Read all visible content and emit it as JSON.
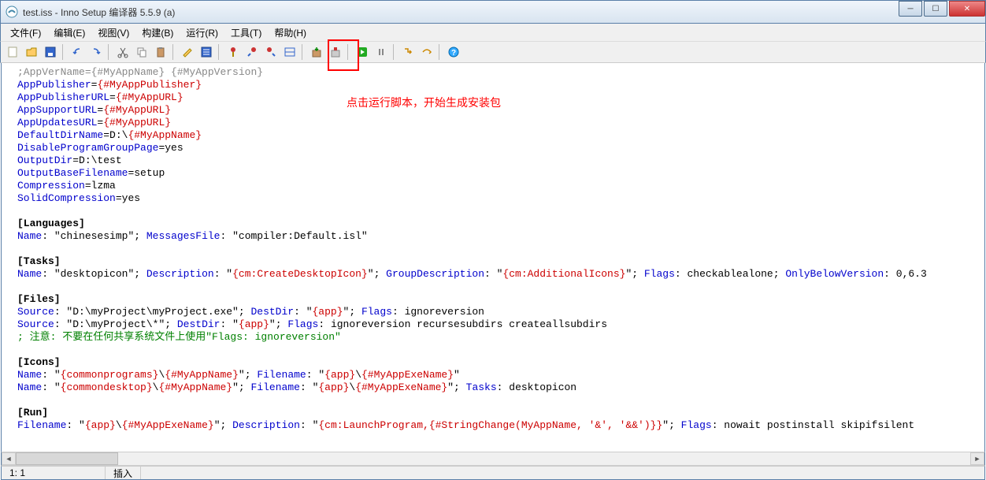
{
  "window": {
    "title": "test.iss - Inno Setup 编译器 5.5.9 (a)"
  },
  "menu": {
    "items": [
      "文件(F)",
      "编辑(E)",
      "视图(V)",
      "构建(B)",
      "运行(R)",
      "工具(T)",
      "帮助(H)"
    ]
  },
  "annotation": {
    "text": "点击运行脚本，开始生成安装包"
  },
  "status": {
    "pos": "1:  1",
    "mode": "插入"
  },
  "code": {
    "l1_comment": ";AppVerName={#MyAppName} {#MyAppVersion}",
    "l2_key": "AppPublisher",
    "l2_val": "{#MyAppPublisher}",
    "l3_key": "AppPublisherURL",
    "l3_val": "{#MyAppURL}",
    "l4_key": "AppSupportURL",
    "l4_val": "{#MyAppURL}",
    "l5_key": "AppUpdatesURL",
    "l5_val": "{#MyAppURL}",
    "l6_key": "DefaultDirName",
    "l6_val1": "D:\\",
    "l6_val2": "{#MyAppName}",
    "l7_key": "DisableProgramGroupPage",
    "l7_val": "yes",
    "l8_key": "OutputDir",
    "l8_val": "D:\\test",
    "l9_key": "OutputBaseFilename",
    "l9_val": "setup",
    "l10_key": "Compression",
    "l10_val": "lzma",
    "l11_key": "SolidCompression",
    "l11_val": "yes",
    "sec_lang": "[Languages]",
    "lang_name": "Name",
    "lang_name_v": "\"chinesesimp\"",
    "lang_mf": "MessagesFile",
    "lang_mf_v": "\"compiler:Default.isl\"",
    "sec_tasks": "[Tasks]",
    "task_name": "Name",
    "task_name_v": "\"desktopicon\"",
    "task_desc": "Description",
    "task_desc_v1": "\"",
    "task_desc_v2": "{cm:CreateDesktopIcon}",
    "task_desc_v3": "\"",
    "task_gd": "GroupDescription",
    "task_gd_v1": "\"",
    "task_gd_v2": "{cm:AdditionalIcons}",
    "task_gd_v3": "\"",
    "task_flags": "Flags",
    "task_flags_v": "checkablealone",
    "task_obv": "OnlyBelowVersion",
    "task_obv_v": "0,6.3",
    "sec_files": "[Files]",
    "f1_src": "Source",
    "f1_src_v": "\"D:\\myProject\\myProject.exe\"",
    "f1_dd": "DestDir",
    "f1_dd_v1": "\"",
    "f1_dd_v2": "{app}",
    "f1_dd_v3": "\"",
    "f1_fl": "Flags",
    "f1_fl_v": "ignoreversion",
    "f2_src": "Source",
    "f2_src_v": "\"D:\\myProject\\*\"",
    "f2_dd": "DestDir",
    "f2_dd_v1": "\"",
    "f2_dd_v2": "{app}",
    "f2_dd_v3": "\"",
    "f2_fl": "Flags",
    "f2_fl_v": "ignoreversion recursesubdirs createallsubdirs",
    "note": "; 注意: 不要在任何共享系统文件上使用\"Flags: ignoreversion\"",
    "sec_icons": "[Icons]",
    "i1_name": "Name",
    "i1_name_v1": "\"",
    "i1_name_v2": "{commonprograms}",
    "i1_name_v3": "\\",
    "i1_name_v4": "{#MyAppName}",
    "i1_name_v5": "\"",
    "i1_fn": "Filename",
    "i1_fn_v1": "\"",
    "i1_fn_v2": "{app}",
    "i1_fn_v3": "\\",
    "i1_fn_v4": "{#MyAppExeName}",
    "i1_fn_v5": "\"",
    "i2_name": "Name",
    "i2_name_v1": "\"",
    "i2_name_v2": "{commondesktop}",
    "i2_name_v3": "\\",
    "i2_name_v4": "{#MyAppName}",
    "i2_name_v5": "\"",
    "i2_fn": "Filename",
    "i2_fn_v1": "\"",
    "i2_fn_v2": "{app}",
    "i2_fn_v3": "\\",
    "i2_fn_v4": "{#MyAppExeName}",
    "i2_fn_v5": "\"",
    "i2_t": "Tasks",
    "i2_t_v": "desktopicon",
    "sec_run": "[Run]",
    "r_fn": "Filename",
    "r_fn_v1": "\"",
    "r_fn_v2": "{app}",
    "r_fn_v3": "\\",
    "r_fn_v4": "{#MyAppExeName}",
    "r_fn_v5": "\"",
    "r_d": "Description",
    "r_d_v1": "\"",
    "r_d_v2": "{cm:LaunchProgram,{#StringChange(MyAppName, '&', '&&')}}",
    "r_d_v3": "\"",
    "r_fl": "Flags",
    "r_fl_v": "nowait postinstall skipifsilent",
    "sep": "; ",
    "eq": "=",
    "colon": ": "
  }
}
